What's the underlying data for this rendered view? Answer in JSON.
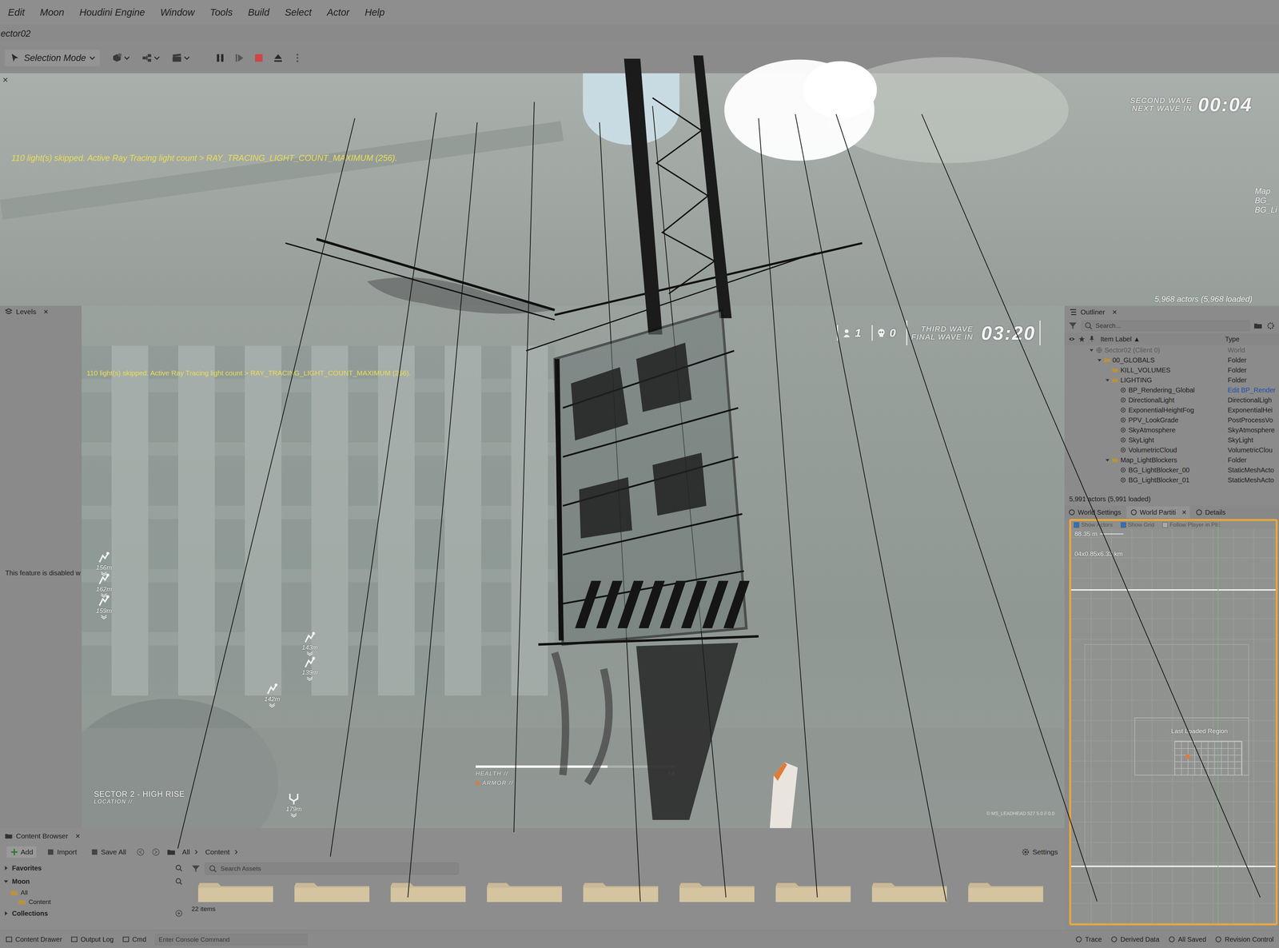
{
  "menu": [
    "Edit",
    "Moon",
    "Houdini Engine",
    "Window",
    "Tools",
    "Build",
    "Select",
    "Actor",
    "Help"
  ],
  "level_tab": "ector02",
  "toolbar": {
    "mode": "Selection Mode"
  },
  "upper_viewport": {
    "close": "×",
    "warning": "110 light(s) skipped. Active Ray Tracing light count > RAY_TRACING_LIGHT_COUNT_MAXIMUM (256).",
    "wave_label": [
      "SECOND WAVE",
      "NEXT WAVE IN"
    ],
    "timer": "00:04",
    "actors": "5,968 actors (5,968 loaded)",
    "ghost_items": [
      "Map",
      "BG_",
      "BG_Li"
    ]
  },
  "levels_panel": {
    "title": "Levels",
    "close": "×",
    "message": "This feature is disabled w"
  },
  "viewport": {
    "warning": "110 light(s) skipped. Active Ray Tracing light count > RAY_TRACING_LIGHT_COUNT_MAXIMUM (256).",
    "players": "1",
    "deaths": "0",
    "wave_label": [
      "THIRD WAVE",
      "FINAL WAVE IN"
    ],
    "timer": "03:20",
    "markers": [
      {
        "distance": "156m",
        "kind": "objective"
      },
      {
        "distance": "162m",
        "kind": "objective"
      },
      {
        "distance": "159m",
        "kind": "objective"
      },
      {
        "distance": "143m",
        "kind": "objective"
      },
      {
        "distance": "139m",
        "kind": "objective"
      },
      {
        "distance": "142m",
        "kind": "objective"
      },
      {
        "distance": "179m",
        "kind": "spawn"
      }
    ],
    "sector": "SECTOR 2 - HIGH RISE",
    "location": "LOCATION //",
    "health": {
      "label": "HEALTH //",
      "value": "66",
      "level": 0.66
    },
    "armor": {
      "label": "ARMOR //"
    },
    "build_info": "© MS_LEADHEAD 527 5.0 // 0.0"
  },
  "outliner": {
    "title": "Outliner",
    "close": "×",
    "search_placeholder": "Search...",
    "columns": [
      "Item Label ▲",
      "Type"
    ],
    "rows": [
      {
        "label": "Sector02 (Client 0)",
        "type": "World",
        "depth": 0,
        "expanded": true,
        "kind": "world",
        "dimmed": true
      },
      {
        "label": "00_GLOBALS",
        "type": "Folder",
        "depth": 1,
        "expanded": true,
        "kind": "folder",
        "dimmed": false
      },
      {
        "label": "KILL_VOLUMES",
        "type": "Folder",
        "depth": 2,
        "expanded": false,
        "kind": "folder",
        "dimmed": false
      },
      {
        "label": "LIGHTING",
        "type": "Folder",
        "depth": 2,
        "expanded": true,
        "kind": "folder",
        "dimmed": false
      },
      {
        "label": "BP_Rendering_Global",
        "type": "Edit BP_Render",
        "depth": 3,
        "expanded": false,
        "kind": "link",
        "dimmed": false
      },
      {
        "label": "DirectionalLight",
        "type": "DirectionalLigh",
        "depth": 3,
        "expanded": false,
        "kind": "actor",
        "dimmed": false
      },
      {
        "label": "ExponentialHeightFog",
        "type": "ExponentialHei",
        "depth": 3,
        "expanded": false,
        "kind": "actor",
        "dimmed": false
      },
      {
        "label": "PPV_LookGrade",
        "type": "PostProcessVo",
        "depth": 3,
        "expanded": false,
        "kind": "actor",
        "dimmed": false
      },
      {
        "label": "SkyAtmosphere",
        "type": "SkyAtmosphere",
        "depth": 3,
        "expanded": false,
        "kind": "actor",
        "dimmed": false
      },
      {
        "label": "SkyLight",
        "type": "SkyLight",
        "depth": 3,
        "expanded": false,
        "kind": "actor",
        "dimmed": false
      },
      {
        "label": "VolumetricCloud",
        "type": "VolumetricClou",
        "depth": 3,
        "expanded": false,
        "kind": "actor",
        "dimmed": false
      },
      {
        "label": "Map_LightBlockers",
        "type": "Folder",
        "depth": 2,
        "expanded": true,
        "kind": "folder",
        "dimmed": false
      },
      {
        "label": "BG_LightBlocker_00",
        "type": "StaticMeshActo",
        "depth": 3,
        "expanded": false,
        "kind": "actor",
        "dimmed": false
      },
      {
        "label": "BG_LightBlocker_01",
        "type": "StaticMeshActo",
        "depth": 3,
        "expanded": false,
        "kind": "actor",
        "dimmed": false
      }
    ],
    "count": "5,991 actors (5,991 loaded)"
  },
  "details_tabs": [
    {
      "label": "World Settings",
      "selected": false,
      "close": ""
    },
    {
      "label": "World Partiti",
      "selected": true,
      "close": "×"
    },
    {
      "label": "Details",
      "selected": false,
      "close": ""
    }
  ],
  "world_partition": {
    "options": [
      {
        "label": "Show Actors",
        "checked": true
      },
      {
        "label": "Show Grid",
        "checked": true
      },
      {
        "label": "Follow Player in PIE",
        "checked": false
      }
    ],
    "scale": "88.35 m",
    "size": "04x0.85x6.33 km",
    "region_label": "Last Loaded Region"
  },
  "content_browser": {
    "title": "Content Browser",
    "close": "×",
    "buttons": [
      "Add",
      "Import",
      "Save All"
    ],
    "path": [
      "All",
      "Content"
    ],
    "settings": "Settings",
    "sections": [
      {
        "label": "Favorites",
        "expanded": false
      },
      {
        "label": "Moon",
        "expanded": true
      }
    ],
    "tree": [
      "All",
      "Content"
    ],
    "collections": "Collections",
    "search_placeholder": "Search Assets",
    "folders": [
      {
        "selected": false
      },
      {
        "selected": false
      },
      {
        "selected": false
      },
      {
        "selected": false
      },
      {
        "selected": false
      },
      {
        "selected": false
      },
      {
        "selected": false
      },
      {
        "selected": false
      },
      {
        "selected": false
      }
    ],
    "item_count": "22 items"
  },
  "status_bar": {
    "left": [
      "Content Drawer",
      "Output Log",
      "Cmd"
    ],
    "console_placeholder": "Enter Console Command",
    "right": [
      "Trace",
      "Derived Data",
      "All Saved",
      "Revision Control"
    ]
  }
}
